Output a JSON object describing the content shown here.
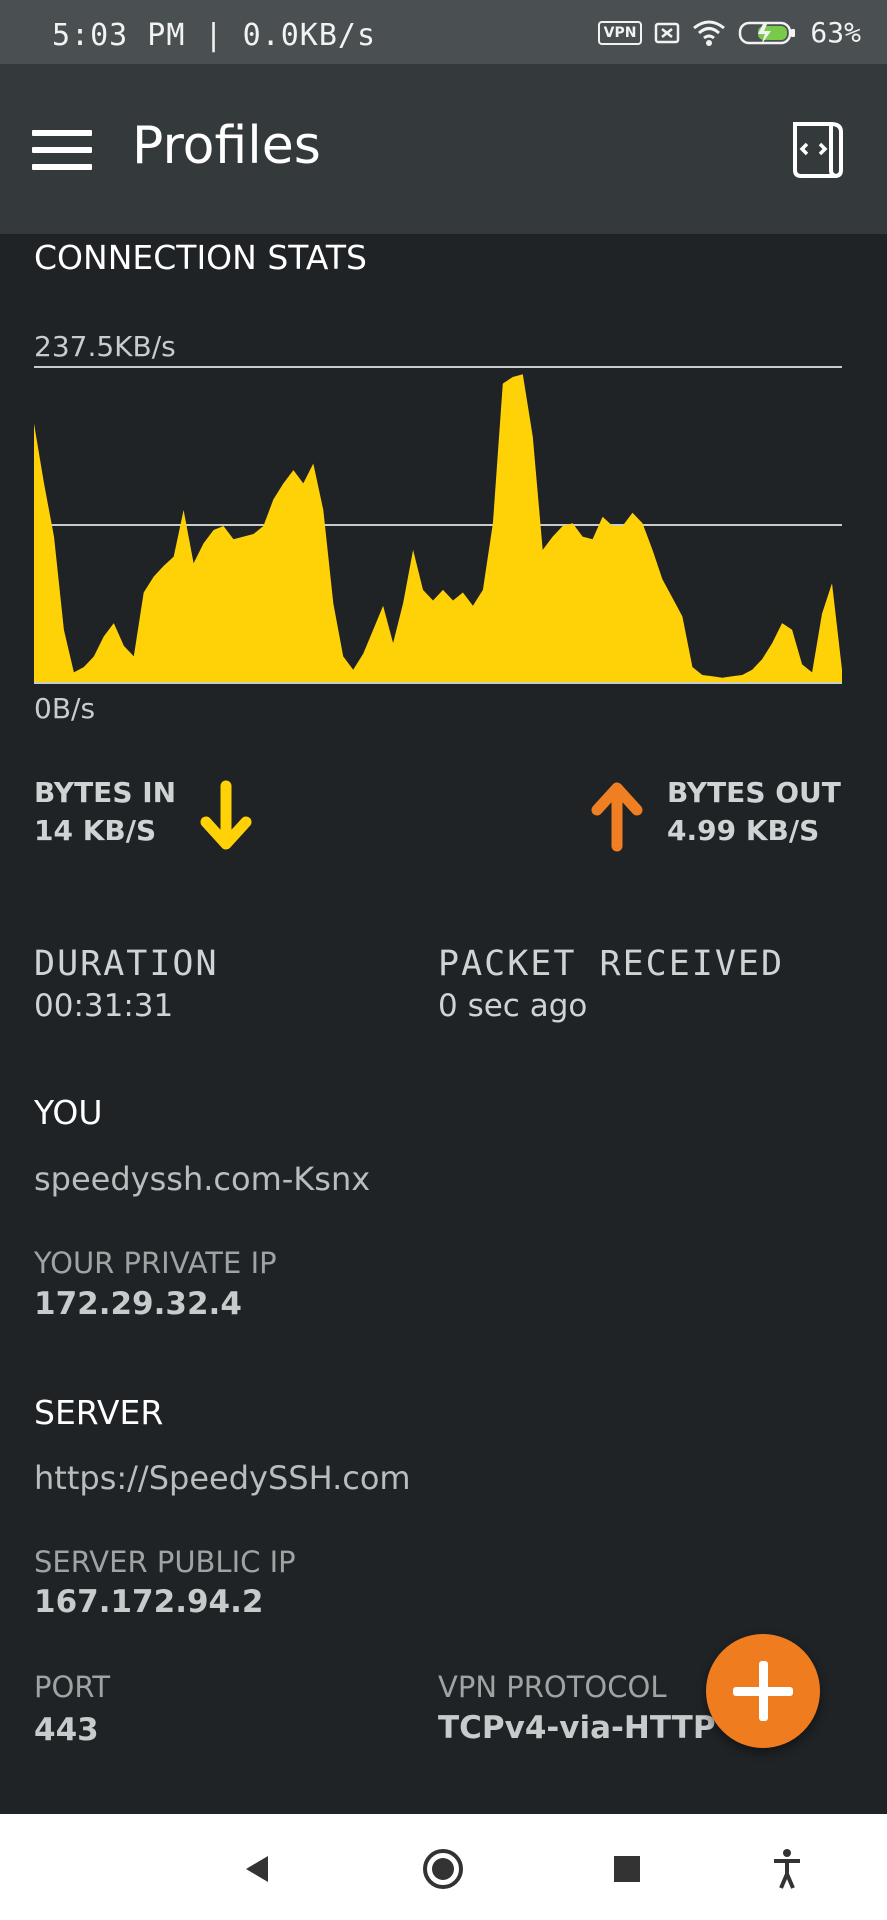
{
  "status_bar": {
    "time_text": "5:03 PM | 0.0KB/s",
    "vpn_badge": "VPN",
    "battery_percent": "63%",
    "icons": [
      "vpn-icon",
      "notification-off-icon",
      "wifi-icon",
      "battery-charging-icon"
    ]
  },
  "app_bar": {
    "title": "Profiles",
    "menu_icon": "hamburger-menu-icon",
    "action_icon": "log-document-icon"
  },
  "connection_stats": {
    "title": "CONNECTION STATS"
  },
  "chart_data": {
    "type": "area",
    "title": "",
    "ymax_label": "237.5KB/s",
    "ymin_label": "0B/s",
    "ylim": [
      0,
      237.5
    ],
    "color": "#ffd208",
    "grid": true,
    "values": [
      195,
      150,
      110,
      40,
      8,
      12,
      20,
      35,
      45,
      28,
      20,
      68,
      80,
      88,
      95,
      130,
      90,
      105,
      115,
      118,
      108,
      110,
      112,
      118,
      138,
      150,
      160,
      150,
      165,
      130,
      60,
      20,
      10,
      22,
      40,
      58,
      30,
      60,
      100,
      70,
      62,
      70,
      62,
      68,
      58,
      70,
      120,
      225,
      230,
      232,
      185,
      100,
      110,
      118,
      120,
      110,
      108,
      125,
      118,
      118,
      128,
      120,
      100,
      78,
      64,
      50,
      12,
      6,
      5,
      4,
      5,
      6,
      10,
      18,
      30,
      45,
      40,
      14,
      8,
      52,
      75,
      10
    ]
  },
  "bytes_in": {
    "label": "BYTES IN",
    "value": "14 KB/S",
    "color": "#ffd208",
    "icon": "arrow-down-icon"
  },
  "bytes_out": {
    "label": "BYTES OUT",
    "value": "4.99 KB/S",
    "color": "#f07f24",
    "icon": "arrow-up-icon"
  },
  "duration": {
    "label": "DURATION",
    "value": "00:31:31"
  },
  "packet": {
    "label": "PACKET RECEIVED",
    "value": "0 sec ago"
  },
  "you": {
    "heading": "YOU",
    "profile": "speedyssh.com-Ksnx",
    "private_ip_label": "YOUR PRIVATE IP",
    "private_ip": "172.29.32.4"
  },
  "server": {
    "heading": "SERVER",
    "url": "https://SpeedySSH.com",
    "public_ip_label": "SERVER PUBLIC IP",
    "public_ip": "167.172.94.2",
    "port_label": "PORT",
    "port": "443",
    "protocol_label": "VPN PROTOCOL",
    "protocol": "TCPv4-via-HTTP"
  },
  "fab": {
    "icon": "plus-icon",
    "color": "#ef7d1f"
  },
  "nav_bar": {
    "icons": [
      "back-icon",
      "home-icon",
      "recents-icon",
      "accessibility-icon"
    ]
  }
}
